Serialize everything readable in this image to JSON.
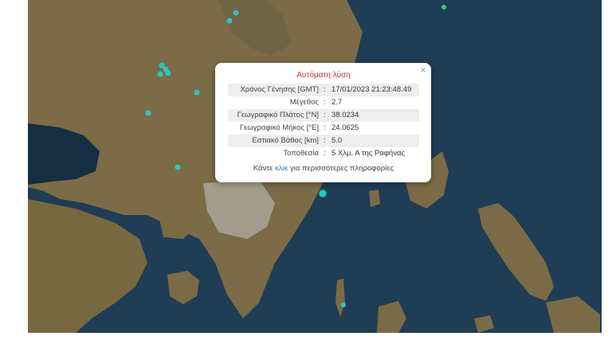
{
  "map": {
    "colors": {
      "sea": "#1d3b52",
      "land": "#7a6a45",
      "sea_dark": "#142c3f",
      "marker": "#2ec4c4",
      "marker_green": "#3ac48a"
    }
  },
  "popup": {
    "title": "Αυτόματη λύση",
    "close_icon": "close-icon",
    "rows": [
      {
        "label": "Χρόνος Γένησης [GMT]",
        "value": "17/01/2023 21:23:48.49"
      },
      {
        "label": "Μέγεθος",
        "value": "2.7"
      },
      {
        "label": "Γεωγραφικό Πλάτος [°N]",
        "value": "38.0234"
      },
      {
        "label": "Γεωγραφικό Μήκος [°E]",
        "value": "24.0625"
      },
      {
        "label": "Εστιακό Βάθος [km]",
        "value": "5.0"
      },
      {
        "label": "Τοποθεσία",
        "value": "5 Χλμ. Α της Ραφήνας"
      }
    ],
    "more_prefix": "Κάντε ",
    "more_link": "κλικ",
    "more_suffix": " για περισσότερες πληροφορίες"
  }
}
